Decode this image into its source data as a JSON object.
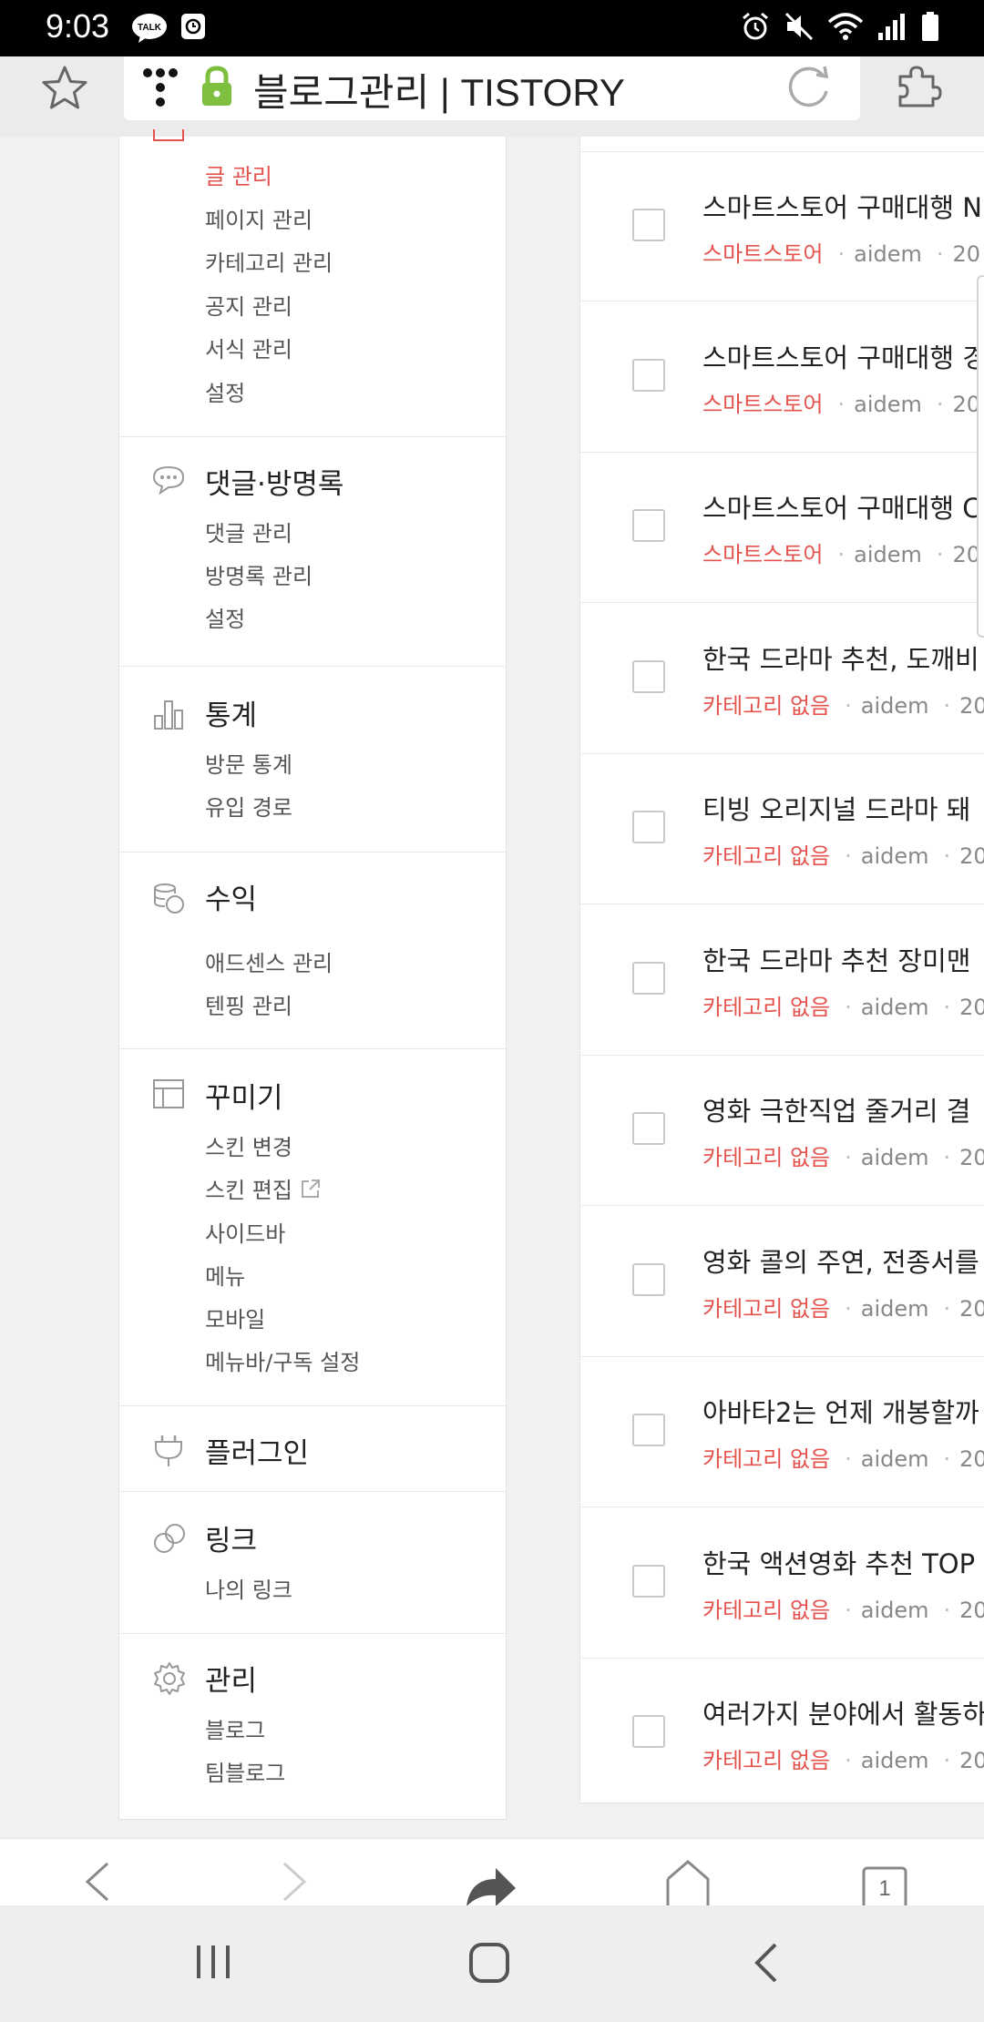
{
  "status_bar": {
    "time": "9:03",
    "left_icons": [
      "talk-notification-icon",
      "clock-app-icon"
    ],
    "right_icons": [
      "alarm-icon",
      "mute-icon",
      "wifi-icon",
      "signal-icon",
      "battery-icon"
    ],
    "talk_badge": "TALK"
  },
  "browser": {
    "url_title": "블로그관리 | TISTORY",
    "tab_count": "1",
    "accent_lock": "#7fbf3f"
  },
  "menu": {
    "posts": {
      "items": [
        "글 관리",
        "페이지 관리",
        "카테고리 관리",
        "공지 관리",
        "서식 관리",
        "설정"
      ]
    },
    "comments": {
      "title": "댓글·방명록",
      "items": [
        "댓글 관리",
        "방명록 관리",
        "설정"
      ]
    },
    "stats": {
      "title": "통계",
      "items": [
        "방문 통계",
        "유입 경로"
      ]
    },
    "revenue": {
      "title": "수익",
      "items": [
        "애드센스 관리",
        "텐핑 관리"
      ]
    },
    "design": {
      "title": "꾸미기",
      "items": [
        "스킨 변경",
        "스킨 편집",
        "사이드바",
        "메뉴",
        "모바일",
        "메뉴바/구독 설정"
      ]
    },
    "plugin": {
      "title": "플러그인"
    },
    "link": {
      "title": "링크",
      "items": [
        "나의 링크"
      ]
    },
    "admin": {
      "title": "관리",
      "items": [
        "블로그",
        "팀블로그"
      ]
    }
  },
  "posts": [
    {
      "title": "스마트스토어 구매대행 N",
      "category": "스마트스토어",
      "author": "aidem",
      "date": "20"
    },
    {
      "title": "스마트스토어 구매대행 경",
      "category": "스마트스토어",
      "author": "aidem",
      "date": "20"
    },
    {
      "title": "스마트스토어 구매대행 C",
      "category": "스마트스토어",
      "author": "aidem",
      "date": "20"
    },
    {
      "title": "한국 드라마 추천, 도깨비",
      "category": "카테고리 없음",
      "author": "aidem",
      "date": "20"
    },
    {
      "title": "티빙 오리지널 드라마 돼",
      "category": "카테고리 없음",
      "author": "aidem",
      "date": "20"
    },
    {
      "title": "한국 드라마 추천 장미맨",
      "category": "카테고리 없음",
      "author": "aidem",
      "date": "20"
    },
    {
      "title": "영화 극한직업 줄거리 결",
      "category": "카테고리 없음",
      "author": "aidem",
      "date": "20"
    },
    {
      "title": "영화 콜의 주연, 전종서를",
      "category": "카테고리 없음",
      "author": "aidem",
      "date": "20"
    },
    {
      "title": "아바타2는 언제 개봉할까",
      "category": "카테고리 없음",
      "author": "aidem",
      "date": "20"
    },
    {
      "title": "한국 액션영화 추천 TOP",
      "category": "카테고리 없음",
      "author": "aidem",
      "date": "20"
    },
    {
      "title": "여러가지 분야에서 활동하",
      "category": "카테고리 없음",
      "author": "aidem",
      "date": "20"
    }
  ],
  "colors": {
    "accent_red": "#e4534e",
    "text": "#222222",
    "muted": "#888888"
  }
}
